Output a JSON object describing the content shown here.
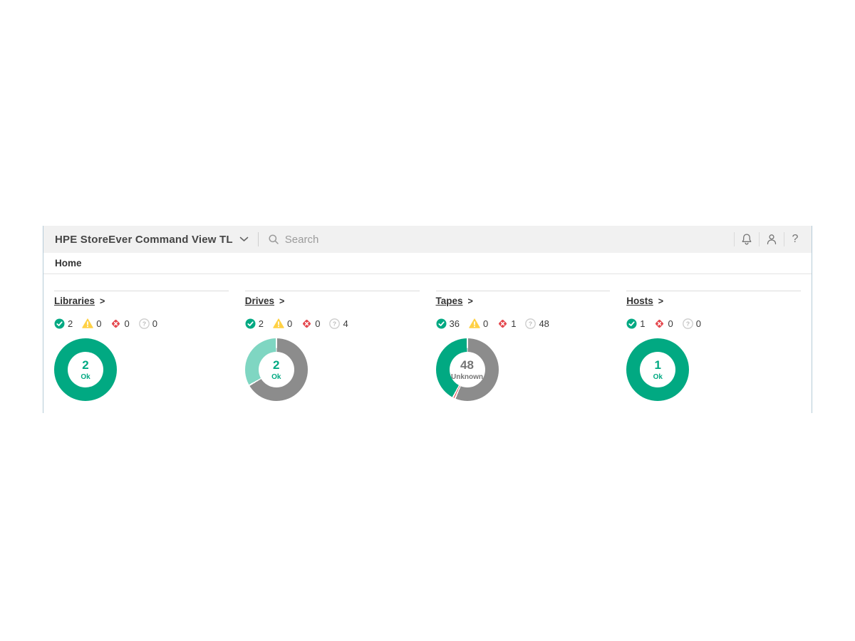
{
  "colors": {
    "green": "#01A982",
    "mint": "#7FD6C2",
    "gray_segment": "#8C8C8C",
    "red": "#E5494F",
    "yellow": "#FFD144",
    "label_green": "#01A982",
    "label_gray": "#757575",
    "unknown_ring": "#CCCCCC",
    "unknown_glyph": "#BBBBBB"
  },
  "header": {
    "title": "HPE StoreEver Command View TL",
    "search_placeholder": "Search",
    "icons": {
      "dropdown": "chevron-down",
      "search": "magnifier",
      "notifications": "bell",
      "account": "person",
      "help": "?"
    }
  },
  "breadcrumb": {
    "home": "Home"
  },
  "panels": [
    {
      "title": "Libraries",
      "chevron": ">",
      "statuses": [
        {
          "type": "ok",
          "count": "2"
        },
        {
          "type": "warning",
          "count": "0"
        },
        {
          "type": "critical",
          "count": "0"
        },
        {
          "type": "unknown",
          "count": "0"
        }
      ],
      "donut": {
        "label": "2",
        "sublabel": "Ok",
        "label_color": "#01A982",
        "segments": [
          {
            "name": "ok",
            "color": "#01A982",
            "value": 2
          }
        ]
      }
    },
    {
      "title": "Drives",
      "chevron": ">",
      "statuses": [
        {
          "type": "ok",
          "count": "2"
        },
        {
          "type": "warning",
          "count": "0"
        },
        {
          "type": "critical",
          "count": "0"
        },
        {
          "type": "unknown",
          "count": "4"
        }
      ],
      "donut": {
        "label": "2",
        "sublabel": "Ok",
        "label_color": "#01A982",
        "segments": [
          {
            "name": "ok",
            "color": "#7FD6C2",
            "value": 2
          },
          {
            "name": "unknown",
            "color": "#8C8C8C",
            "value": 4
          }
        ]
      }
    },
    {
      "title": "Tapes",
      "chevron": ">",
      "statuses": [
        {
          "type": "ok",
          "count": "36"
        },
        {
          "type": "warning",
          "count": "0"
        },
        {
          "type": "critical",
          "count": "1"
        },
        {
          "type": "unknown",
          "count": "48"
        }
      ],
      "donut": {
        "label": "48",
        "sublabel": "Unknown",
        "label_color": "#757575",
        "segments": [
          {
            "name": "ok",
            "color": "#01A982",
            "value": 36
          },
          {
            "name": "critical",
            "color": "#E5494F",
            "value": 1
          },
          {
            "name": "unknown",
            "color": "#8C8C8C",
            "value": 48
          }
        ]
      }
    },
    {
      "title": "Hosts",
      "chevron": ">",
      "statuses": [
        {
          "type": "ok",
          "count": "1"
        },
        {
          "type": "critical",
          "count": "0"
        },
        {
          "type": "unknown",
          "count": "0"
        }
      ],
      "donut": {
        "label": "1",
        "sublabel": "Ok",
        "label_color": "#01A982",
        "segments": [
          {
            "name": "ok",
            "color": "#01A982",
            "value": 1
          }
        ]
      }
    }
  ]
}
